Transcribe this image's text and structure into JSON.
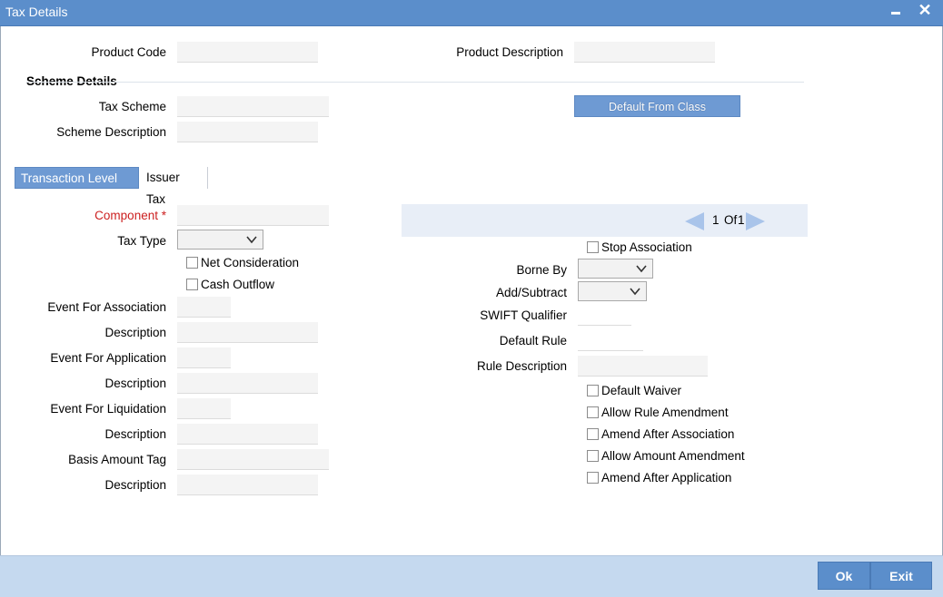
{
  "window": {
    "title": "Tax Details"
  },
  "product": {
    "code_label": "Product Code",
    "desc_label": "Product Description"
  },
  "scheme": {
    "section_title": "Scheme Details",
    "tax_scheme_label": "Tax Scheme",
    "scheme_desc_label": "Scheme Description",
    "default_button": "Default From Class"
  },
  "tabs": [
    {
      "label": "Transaction Level Tax"
    },
    {
      "label": "Issuer Tax"
    }
  ],
  "left": {
    "component_label": "Component",
    "required_mark": "*",
    "tax_type_label": "Tax Type",
    "net_consideration": "Net Consideration",
    "cash_outflow": "Cash Outflow",
    "event_assoc_label": "Event For Association",
    "desc1_label": "Description",
    "event_app_label": "Event For Application",
    "desc2_label": "Description",
    "event_liq_label": "Event For Liquidation",
    "desc3_label": "Description",
    "basis_amount_label": "Basis Amount Tag",
    "desc4_label": "Description"
  },
  "pager": {
    "current": "1",
    "of_text": "Of",
    "total": "1"
  },
  "right": {
    "stop_association": "Stop Association",
    "borne_by_label": "Borne By",
    "add_subtract_label": "Add/Subtract",
    "swift_label": "SWIFT Qualifier",
    "default_rule_label": "Default Rule",
    "rule_desc_label": "Rule Description",
    "checks": [
      "Default Waiver",
      "Allow Rule Amendment",
      "Amend After Association",
      "Allow Amount Amendment",
      "Amend After Application"
    ]
  },
  "footer": {
    "ok": "Ok",
    "exit": "Exit"
  },
  "colors": {
    "title_bar": "#5b8ecb",
    "footer": "#c5d9ef",
    "required": "#cc1f1f"
  },
  "icons": {
    "minimize": "minimize-icon",
    "close": "close-icon",
    "dropdown": "chevron-down-icon",
    "prev": "arrow-left-icon",
    "next": "arrow-right-icon"
  }
}
